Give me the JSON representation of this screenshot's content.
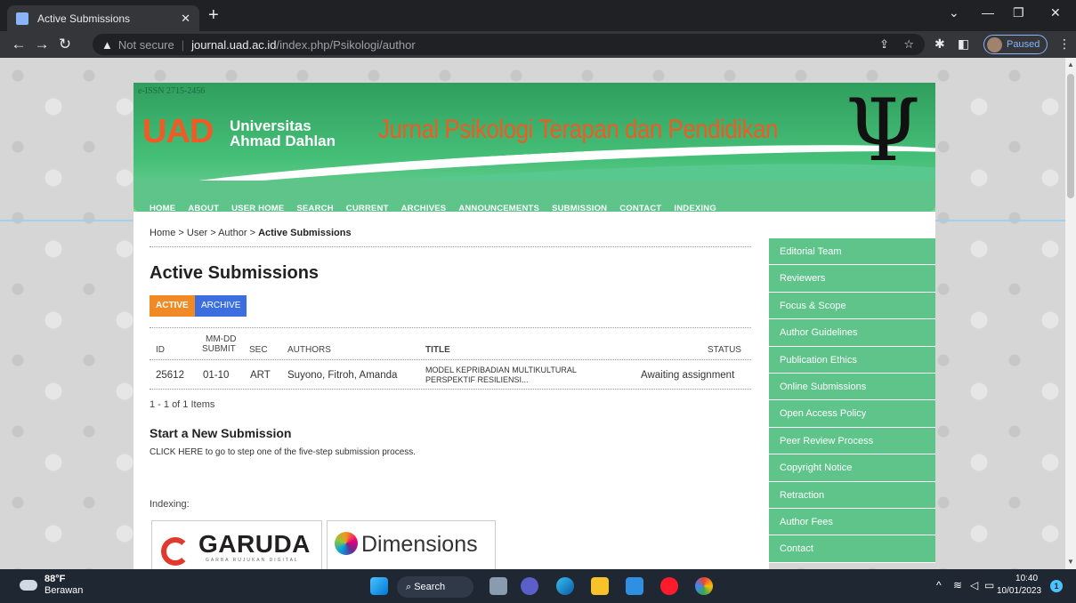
{
  "browser": {
    "tab_title": "Active Submissions",
    "new_tab": "+",
    "url_warning": "Not secure",
    "url_domain": "journal.uad.ac.id",
    "url_path": "/index.php/Psikologi/author",
    "profile_status": "Paused"
  },
  "header": {
    "eissn": "e-ISSN 2715-2456",
    "university_logo": "UAD",
    "university_line1": "Universitas",
    "university_line2": "Ahmad Dahlan",
    "journal_title": "Jurnal Psikologi Terapan dan Pendidikan",
    "emblem": "Ψ"
  },
  "nav": {
    "items": [
      "HOME",
      "ABOUT",
      "USER HOME",
      "SEARCH",
      "CURRENT",
      "ARCHIVES",
      "ANNOUNCEMENTS",
      "SUBMISSION",
      "CONTACT",
      "INDEXING"
    ]
  },
  "breadcrumb": {
    "home": "Home",
    "user": "User",
    "author": "Author",
    "current": "Active Submissions",
    "sep": ">"
  },
  "main": {
    "title": "Active Submissions",
    "tab_active": "ACTIVE",
    "tab_archive": "ARCHIVE",
    "columns": {
      "id": "ID",
      "submit_line1": "MM-DD",
      "submit_line2": "SUBMIT",
      "sec": "SEC",
      "authors": "AUTHORS",
      "title": "TITLE",
      "status": "STATUS"
    },
    "rows": [
      {
        "id": "25612",
        "submit": "01-10",
        "sec": "ART",
        "authors": "Suyono, Fitroh, Amanda",
        "title_line1": "MODEL KEPRIBADIAN MULTIKULTURAL",
        "title_line2": "PERSPEKTIF RESILIENSI...",
        "status": "Awaiting assignment"
      }
    ],
    "count": "1 - 1 of 1 Items",
    "new_submission_heading": "Start a New Submission",
    "click_here": "CLICK HERE",
    "new_submission_text": " to go to step one of the five-step submission process.",
    "indexing_label": "Indexing:",
    "garuda_text": "GARUDA",
    "garuda_sub": "GARBA RUJUKAN DIGITAL",
    "dimensions_text": "Dimensions"
  },
  "sidebar": {
    "items": [
      "Editorial Team",
      "Reviewers",
      "Focus & Scope",
      "Author Guidelines",
      "Publication Ethics",
      "Online Submissions",
      "Open Access Policy",
      "Peer Review Process",
      "Copyright Notice",
      "Retraction",
      "Author Fees",
      "Contact"
    ]
  },
  "taskbar": {
    "temperature": "88°F",
    "weather": "Berawan",
    "search_label": "Search",
    "time": "10:40",
    "date": "10/01/2023",
    "notifications": "1"
  },
  "colors": {
    "accent_green": "#5ec48a",
    "active_orange": "#f08a24",
    "archive_blue": "#3b6fe0",
    "title_orange": "#f15a24"
  }
}
